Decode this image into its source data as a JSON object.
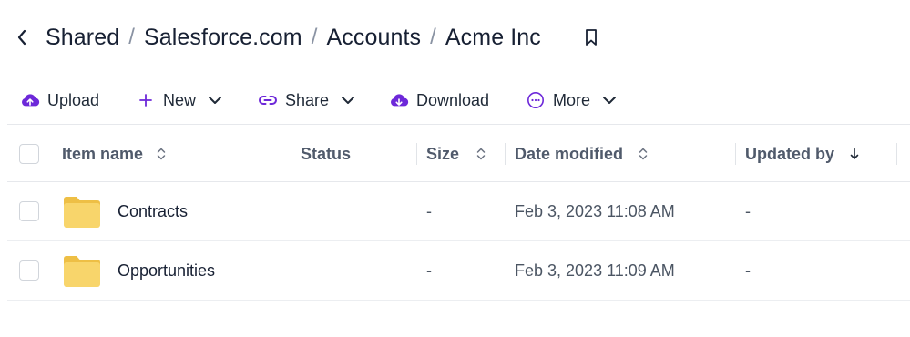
{
  "breadcrumb": {
    "items": [
      "Shared",
      "Salesforce.com",
      "Accounts"
    ],
    "current": "Acme Inc",
    "separator": "/"
  },
  "toolbar": {
    "upload": "Upload",
    "new": "New",
    "share": "Share",
    "download": "Download",
    "more": "More"
  },
  "table": {
    "headers": {
      "name": "Item name",
      "status": "Status",
      "size": "Size",
      "date": "Date modified",
      "updated_by": "Updated by"
    },
    "rows": [
      {
        "name": "Contracts",
        "status": "",
        "size": "-",
        "date": "Feb 3, 2023 11:08 AM",
        "updated_by": "-"
      },
      {
        "name": "Opportunities",
        "status": "",
        "size": "-",
        "date": "Feb 3, 2023 11:09 AM",
        "updated_by": "-"
      }
    ]
  },
  "icons": {
    "back": "chevron-left-icon",
    "bookmark": "bookmark-icon",
    "upload": "cloud-upload-icon",
    "new": "plus-icon",
    "share": "link-icon",
    "download": "cloud-download-icon",
    "more": "more-horizontal-icon",
    "folder": "folder-icon"
  },
  "colors": {
    "accent": "#6d28d9",
    "folder": "#f8d56b",
    "folder_tab": "#eebf45",
    "text": "#172033",
    "header_text": "#505a6b"
  }
}
